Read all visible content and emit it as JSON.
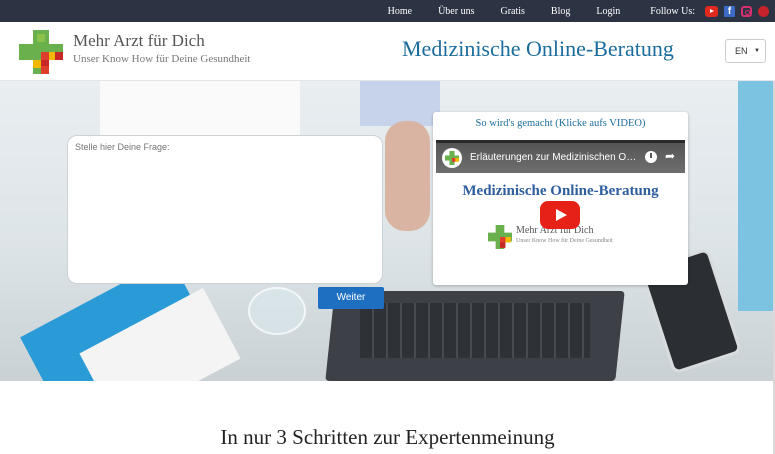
{
  "topbar": {
    "nav": [
      "Home",
      "Über uns",
      "Gratis",
      "Blog",
      "Login"
    ],
    "follow_label": "Follow Us:",
    "social_icons": [
      "youtube-icon",
      "facebook-icon",
      "instagram-icon",
      "pinterest-icon"
    ]
  },
  "header": {
    "brand_name": "Mehr Arzt für Dich",
    "tagline": "Unser Know How für Deine Gesundheit",
    "heading": "Medizinische Online-Beratung",
    "language": "EN"
  },
  "hero": {
    "question_placeholder": "Stelle hier Deine Frage:",
    "submit_label": "Weiter",
    "video_card_title": "So wird's gemacht (Klicke aufs VIDEO)",
    "video_title": "Erläuterungen zur Medizinischen Online-Beratung",
    "video_heading": "Medizinische Online-Beratung",
    "video_brand": "Mehr Arzt für Dich",
    "video_tagline": "Unser Know How für Deine Gesundheit"
  },
  "section": {
    "title": "In nur 3 Schritten zur Expertenmeinung"
  },
  "colors": {
    "topbar": "#2c3444",
    "accent": "#1b6d9c",
    "button": "#1e6fc2"
  }
}
